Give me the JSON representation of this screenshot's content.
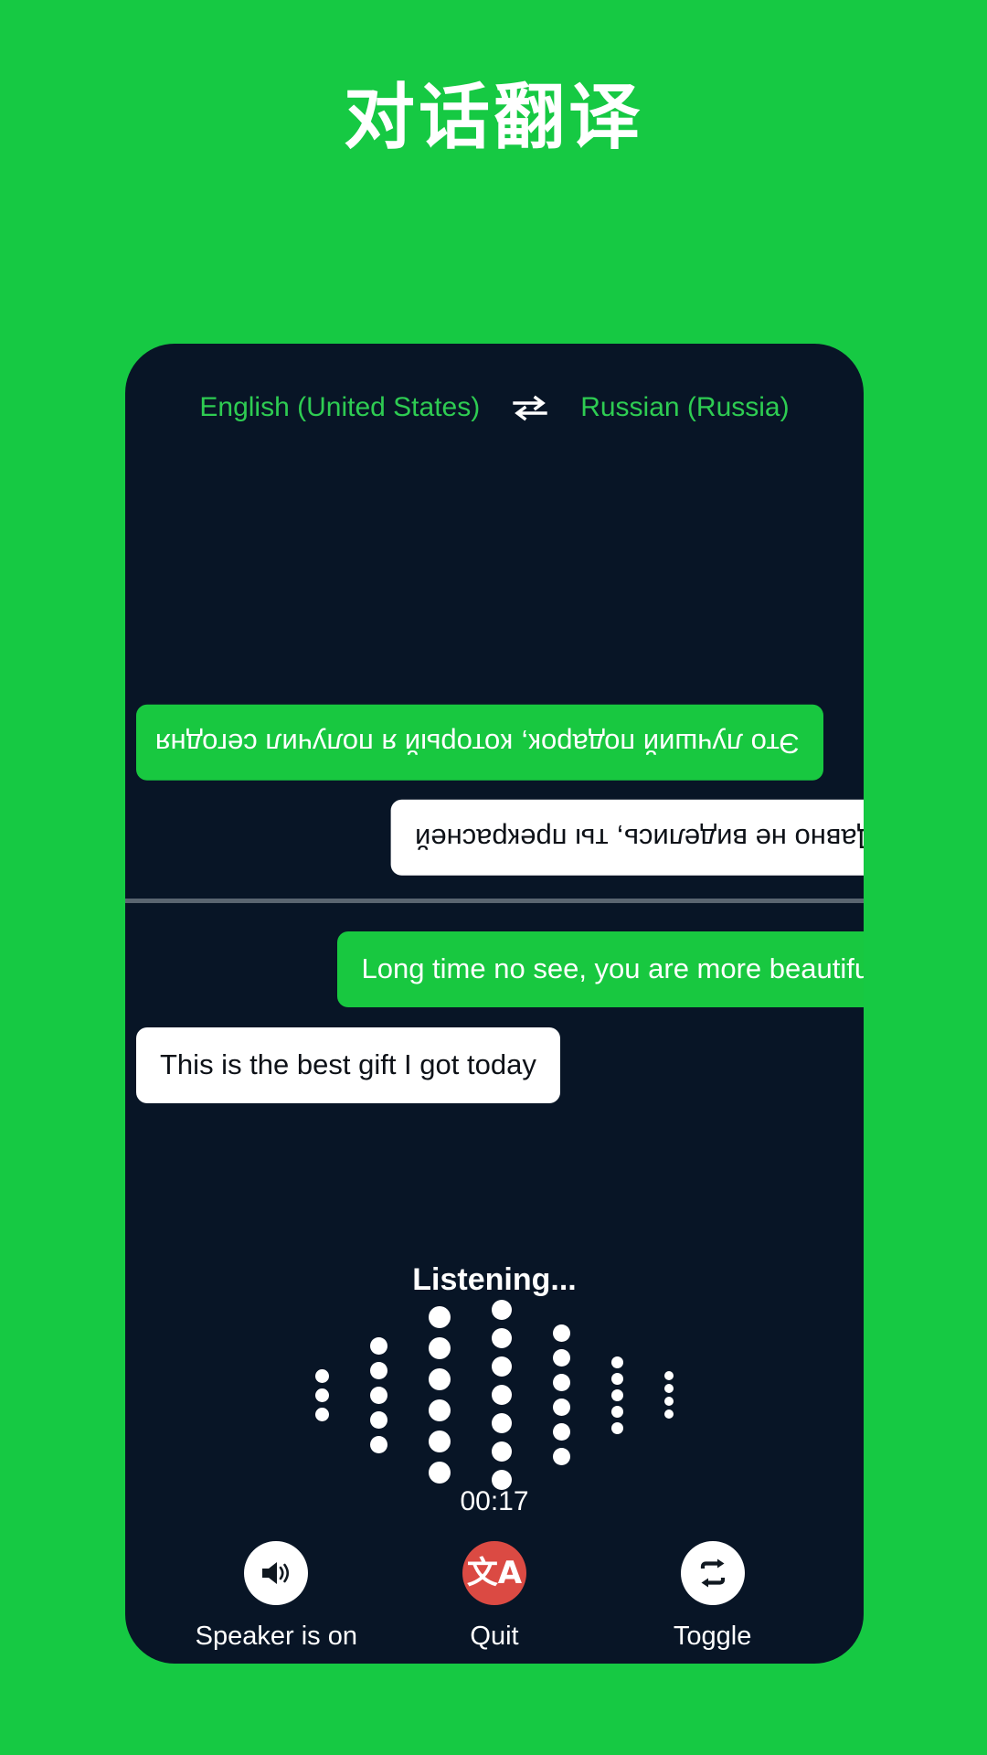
{
  "header": {
    "title": "对话翻译"
  },
  "colors": {
    "background_green": "#16C943",
    "panel_dark": "#081526",
    "bubble_green": "#18C840",
    "bubble_white": "#FFFFFF",
    "lang_green": "#2ECC52",
    "quit_red": "#DB4A43",
    "divider_grey": "#5A6570"
  },
  "language_bar": {
    "source_language": "English (United States)",
    "target_language": "Russian (Russia)",
    "swap_icon": "swap-horizontal-icon"
  },
  "conversation": {
    "remote_messages": [
      {
        "text": "Это лучший подарок, который я получил сегодня",
        "style": "green",
        "align": "left",
        "rotated": true
      },
      {
        "text": "Давно не виделись, ты прекрасней",
        "style": "white",
        "align": "right",
        "rotated": true
      }
    ],
    "local_messages": [
      {
        "text": "Long time no see, you are more beautiful",
        "style": "green",
        "align": "right",
        "rotated": false
      },
      {
        "text": "This is the best gift I got today",
        "style": "white",
        "align": "left",
        "rotated": false
      }
    ]
  },
  "status": {
    "listening_label": "Listening...",
    "timer": "00:17"
  },
  "waveform": {
    "columns": [
      {
        "dots": 3,
        "size": 15
      },
      {
        "dots": 5,
        "size": 19
      },
      {
        "dots": 6,
        "size": 24
      },
      {
        "dots": 7,
        "size": 22
      },
      {
        "dots": 6,
        "size": 19
      },
      {
        "dots": 5,
        "size": 13
      },
      {
        "dots": 4,
        "size": 10
      }
    ]
  },
  "controls": [
    {
      "label": "Speaker is on",
      "icon": "speaker-on-icon",
      "circle": "white"
    },
    {
      "label": "Quit",
      "icon": "translate-icon",
      "circle": "red",
      "glyph": "文A"
    },
    {
      "label": "Toggle",
      "icon": "repeat-swap-icon",
      "circle": "white"
    }
  ]
}
